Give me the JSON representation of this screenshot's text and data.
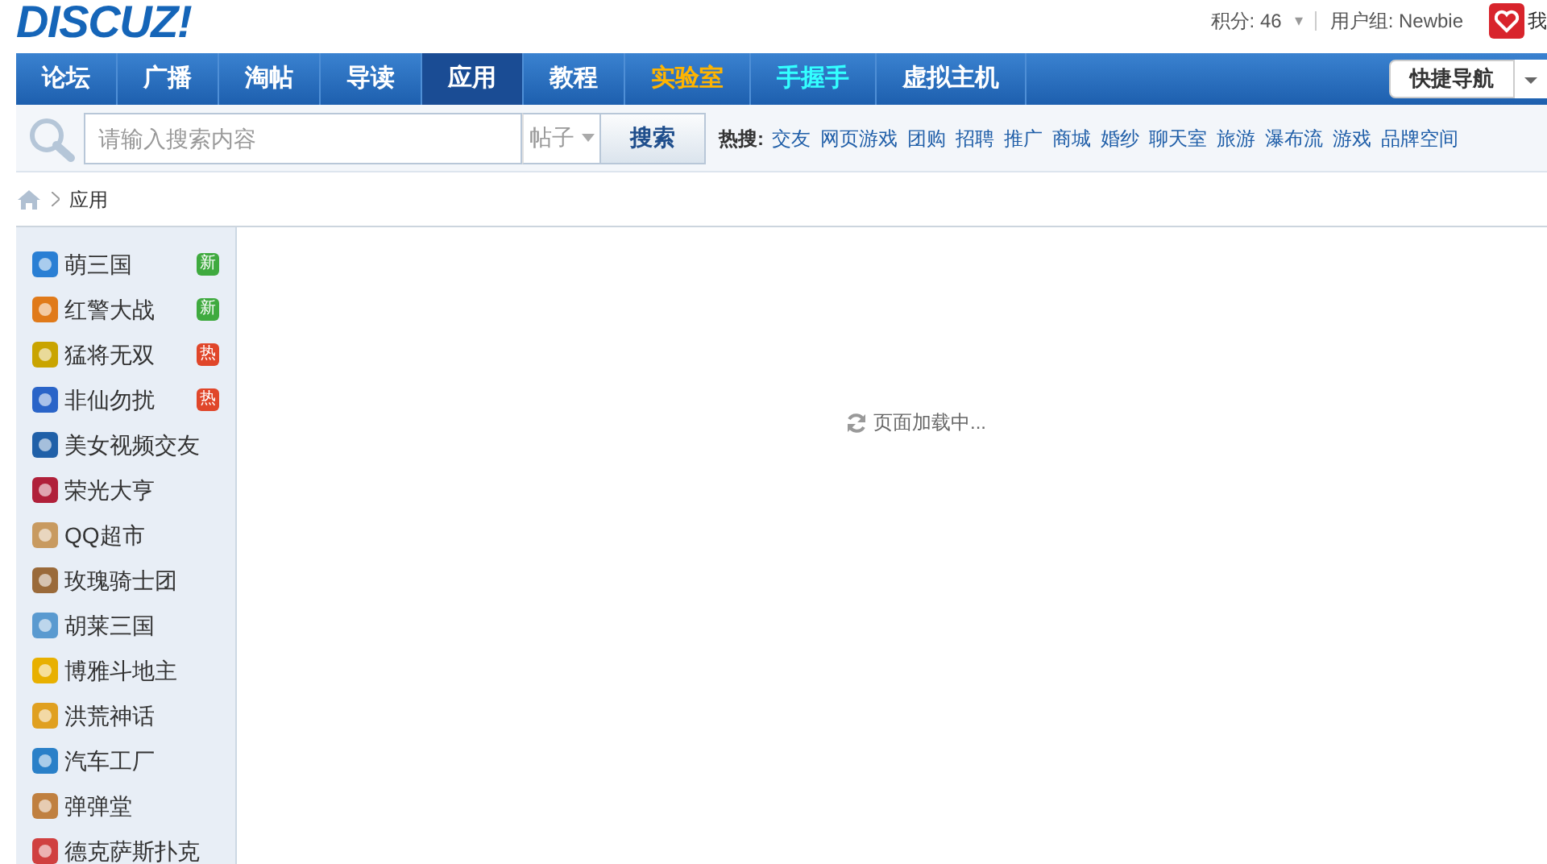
{
  "logo": "DISCUZ!",
  "user": {
    "points": "积分: 46",
    "caret": "▾",
    "group": "用户组: Newbie",
    "cut_text": "我"
  },
  "nav": {
    "items": [
      {
        "label": "论坛",
        "selected": false,
        "kind": "plain"
      },
      {
        "label": "广播",
        "selected": false,
        "kind": "plain"
      },
      {
        "label": "淘帖",
        "selected": false,
        "kind": "plain"
      },
      {
        "label": "导读",
        "selected": false,
        "kind": "plain"
      },
      {
        "label": "应用",
        "selected": true,
        "kind": "plain"
      },
      {
        "label": "教程",
        "selected": false,
        "kind": "plain"
      },
      {
        "label": "实验室",
        "selected": false,
        "kind": "orange"
      },
      {
        "label": "手握手",
        "selected": false,
        "kind": "cyan"
      },
      {
        "label": "虚拟主机",
        "selected": false,
        "kind": "plain"
      }
    ],
    "quick_nav": "快捷导航"
  },
  "search": {
    "placeholder": "请输入搜索内容",
    "scope": "帖子",
    "button": "搜索",
    "hot_label": "热搜:",
    "hot": [
      "交友",
      "网页游戏",
      "团购",
      "招聘",
      "推广",
      "商城",
      "婚纱",
      "聊天室",
      "旅游",
      "瀑布流",
      "游戏",
      "品牌空间"
    ]
  },
  "breadcrumb": [
    "应用"
  ],
  "sidebar": {
    "items": [
      {
        "label": "萌三国",
        "badge": {
          "text": "新",
          "color": "#3faa3f"
        },
        "color": "#2a7fd4"
      },
      {
        "label": "红警大战",
        "badge": {
          "text": "新",
          "color": "#3faa3f"
        },
        "color": "#e07a1a"
      },
      {
        "label": "猛将无双",
        "badge": {
          "text": "热",
          "color": "#e0462a"
        },
        "color": "#c9a400"
      },
      {
        "label": "非仙勿扰",
        "badge": {
          "text": "热",
          "color": "#e0462a"
        },
        "color": "#2a64c8"
      },
      {
        "label": "美女视频交友",
        "color": "#2060a8"
      },
      {
        "label": "荣光大亨",
        "color": "#b0203a"
      },
      {
        "label": "QQ超市",
        "color": "#c89a60"
      },
      {
        "label": "玫瑰骑士团",
        "color": "#9a6a3a"
      },
      {
        "label": "胡莱三国",
        "color": "#5a9ad0"
      },
      {
        "label": "博雅斗地主",
        "color": "#e8b000"
      },
      {
        "label": "洪荒神话",
        "color": "#e0a020"
      },
      {
        "label": "汽车工厂",
        "color": "#2a80c8"
      },
      {
        "label": "弹弹堂",
        "color": "#c08040"
      },
      {
        "label": "德克萨斯扑克",
        "color": "#d04040"
      }
    ]
  },
  "loading": "页面加载中..."
}
